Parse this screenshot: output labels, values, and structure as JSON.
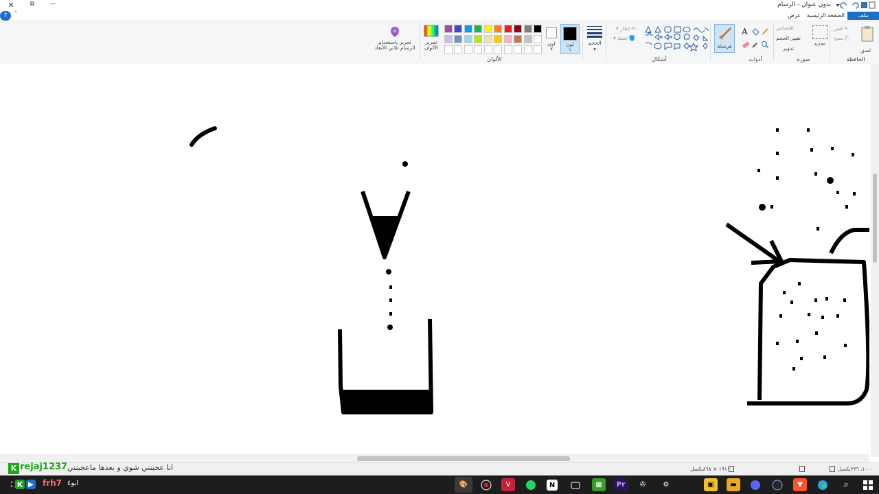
{
  "window": {
    "title": "بدون عنوان - الرسام",
    "close": "✕",
    "restore": "⧉",
    "minimize": "—"
  },
  "tabs": [
    {
      "label": "ملف"
    },
    {
      "label": "الصفحة الرئيسية"
    },
    {
      "label": "عرض"
    }
  ],
  "help": "?",
  "ribbon": {
    "clipboard": {
      "label": "الحافظة",
      "paste": "لصق",
      "cut": "قص",
      "copy": "نسخ"
    },
    "image": {
      "label": "صورة",
      "select": "تحديد",
      "crop": "اقتصاص",
      "resize": "تغيير الحجم",
      "rotate": "تدوير"
    },
    "tools": {
      "label": "أدوات",
      "text": "A"
    },
    "brushes": {
      "label": "فرشاة"
    },
    "shapes": {
      "label": "أشكال",
      "outline": "إطار",
      "fill": "تعبئة"
    },
    "size": {
      "label": "الحجم"
    },
    "color1": {
      "label": "لون\n١",
      "value": "#000000"
    },
    "color2": {
      "label": "لون\n٢",
      "value": "#ffffff"
    },
    "colors": {
      "label": "الألوان",
      "row1": [
        "#000000",
        "#7f7f7f",
        "#880015",
        "#ed1c24",
        "#ff7f27",
        "#fff200",
        "#22b14c",
        "#00a2e8",
        "#3f48cc",
        "#a349a4"
      ],
      "row2": [
        "#ffffff",
        "#c3c3c3",
        "#b97a57",
        "#ffaec9",
        "#ffc90e",
        "#efe4b0",
        "#b5e61d",
        "#99d9ea",
        "#7092be",
        "#c8bfe7"
      ],
      "row3": [
        "#ffffff",
        "#ffffff",
        "#ffffff",
        "#ffffff",
        "#ffffff",
        "#ffffff",
        "#ffffff",
        "#ffffff",
        "#ffffff",
        "#ffffff"
      ]
    },
    "edit_colors": "تحرير الألوان",
    "paint3d": "تحرير باستخدام الرسام ثلاثي الأبعاد"
  },
  "status": {
    "dimensions": "١٩١١ × ٨٦٨بكسل",
    "position": "١٠٠٠، ٢٣٦بكسل"
  },
  "overlay": {
    "username1": "rejaj1237",
    "username2": "frh7",
    "caption": "انا عجبتني شوي و بعدها ماعجبتني",
    "label3": "ابو٤"
  }
}
